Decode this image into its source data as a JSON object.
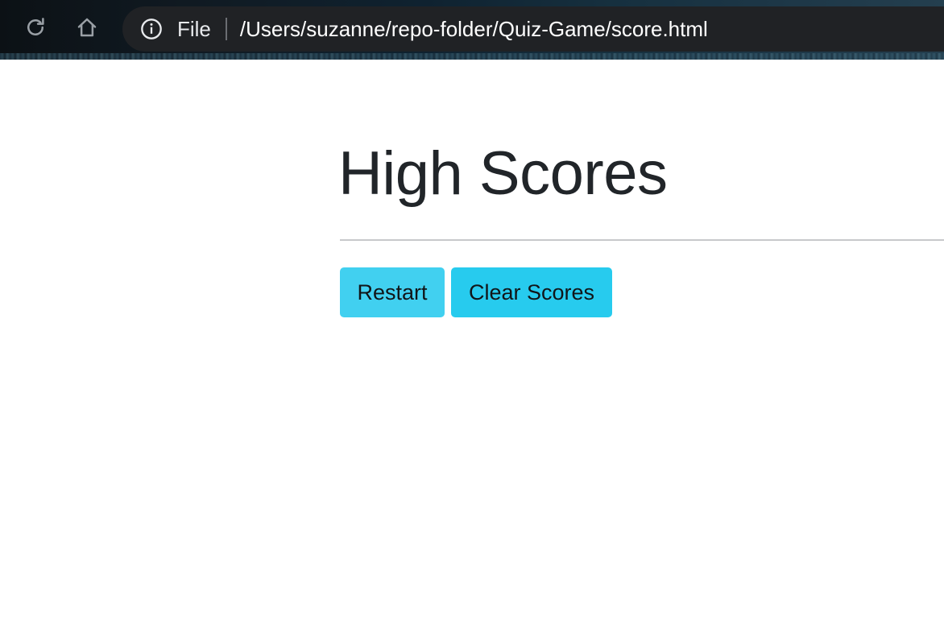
{
  "browser": {
    "scheme_label": "File",
    "url": "/Users/suzanne/repo-folder/Quiz-Game/score.html",
    "icons": {
      "reload": "reload-icon",
      "home": "home-icon",
      "info": "info-icon"
    }
  },
  "page": {
    "title": "High Scores",
    "buttons": {
      "restart_label": "Restart",
      "clear_label": "Clear Scores"
    }
  },
  "colors": {
    "restart_button_bg": "#41d0f0",
    "clear_button_bg": "#27cbee",
    "title_text": "#212529",
    "address_bar_bg": "#202225"
  }
}
